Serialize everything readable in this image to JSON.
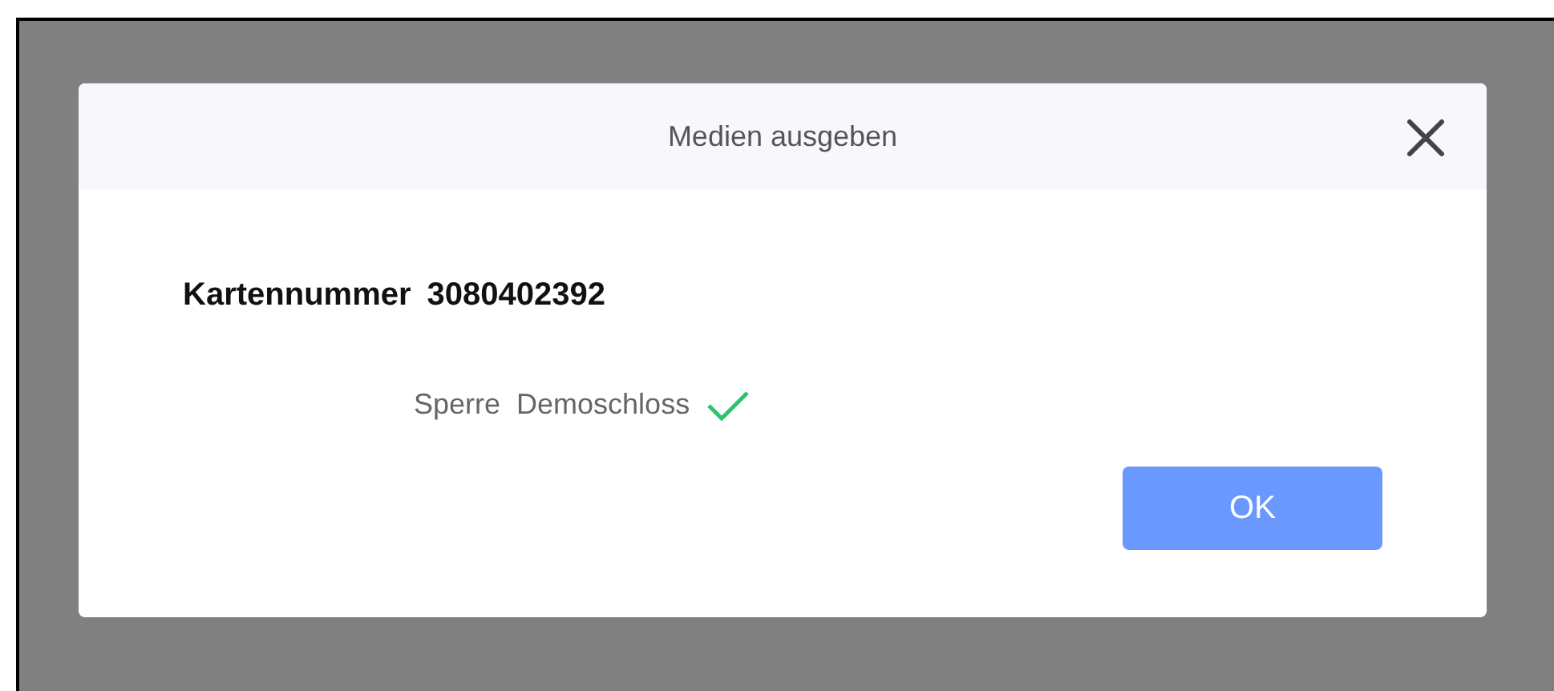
{
  "dialog": {
    "title": "Medien ausgeben",
    "card_label": "Kartennummer",
    "card_number": "3080402392",
    "lock": {
      "label": "Sperre",
      "name": "Demoschloss",
      "success": true
    },
    "buttons": [
      "OK"
    ]
  }
}
